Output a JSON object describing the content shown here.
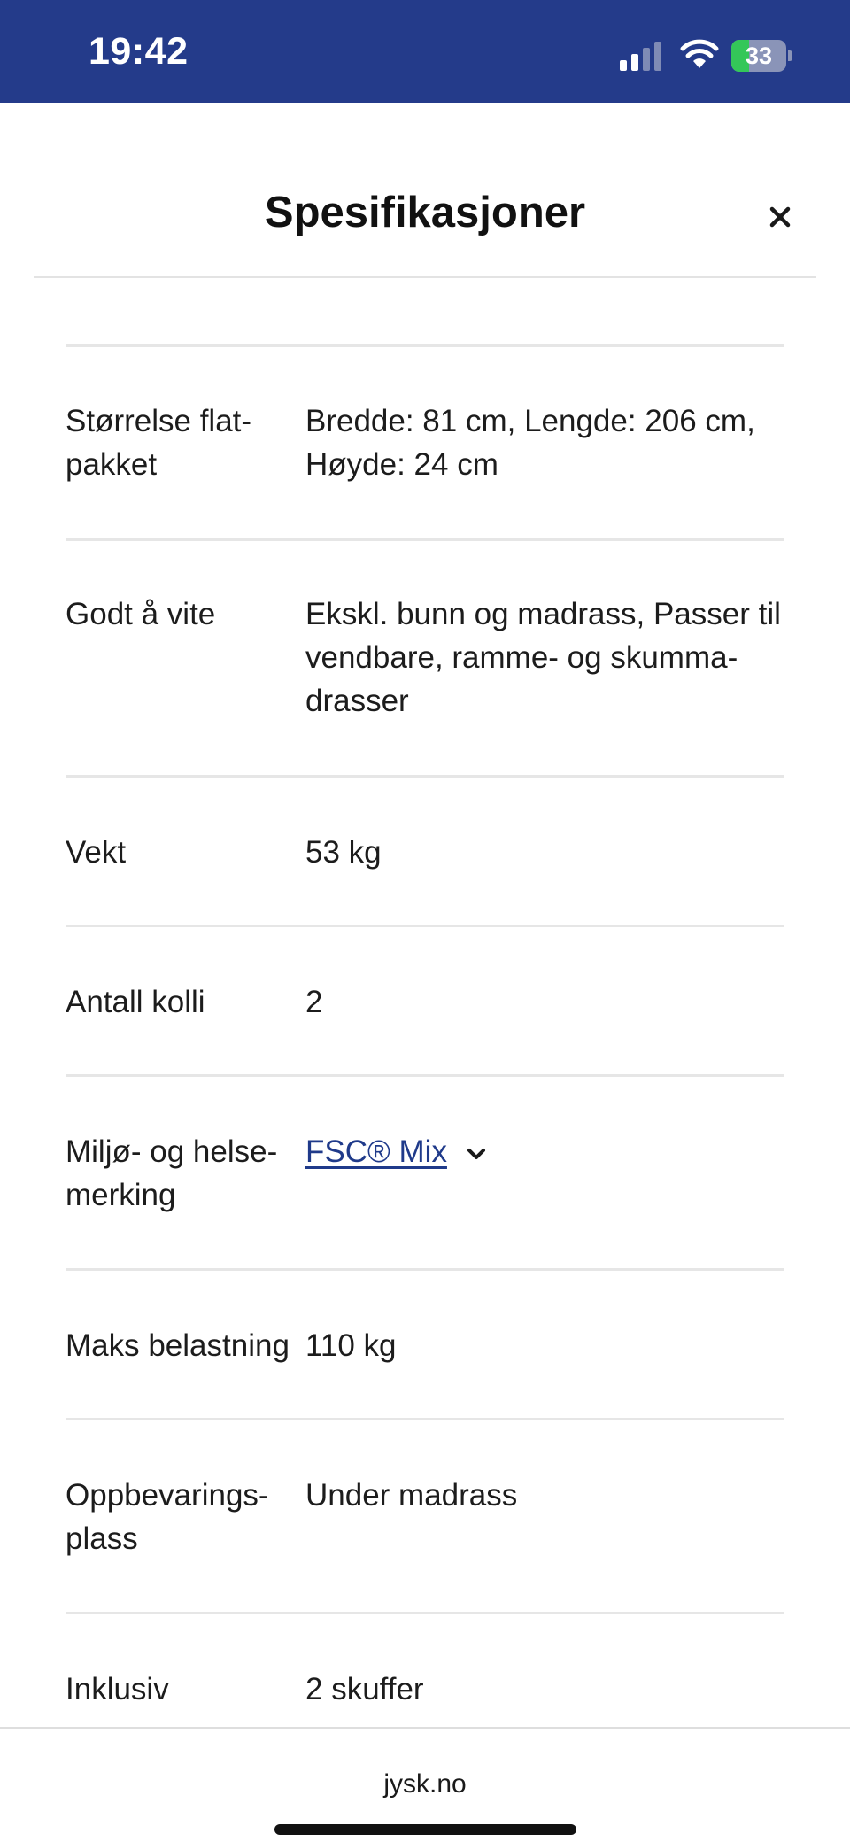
{
  "status_bar": {
    "time": "19:42",
    "battery_percent": 33,
    "battery_label": "33",
    "charging": true,
    "signal_bars_active": 2,
    "signal_bars_total": 4,
    "background_color": "#243b8a"
  },
  "sheet": {
    "title": "Spesifikasjoner",
    "close_icon": "close-icon"
  },
  "specs": [
    {
      "label": "Størrelse flat-\npakket",
      "value": "Bredde: 81 cm, Lengde: 206 cm,\nHøyde: 24 cm"
    },
    {
      "label": "Godt å vite",
      "value": "Ekskl. bunn og madrass, Passer til\nvendbare, ramme- og skumma-\ndrasser"
    },
    {
      "label": "Vekt",
      "value": "53 kg"
    },
    {
      "label": "Antall kolli",
      "value": "2"
    },
    {
      "label": "Miljø- og helse-\nmerking",
      "value": "FSC® Mix",
      "is_link": true,
      "link_color": "#1f3a8a",
      "icon": "chevron-down-icon"
    },
    {
      "label": "Maks belastning",
      "value": "110 kg"
    },
    {
      "label": "Oppbevarings-\nplass",
      "value": "Under madrass"
    },
    {
      "label": "Inklusiv",
      "value": "2 skuffer"
    }
  ],
  "bottom_bar": {
    "domain": "jysk.no"
  }
}
